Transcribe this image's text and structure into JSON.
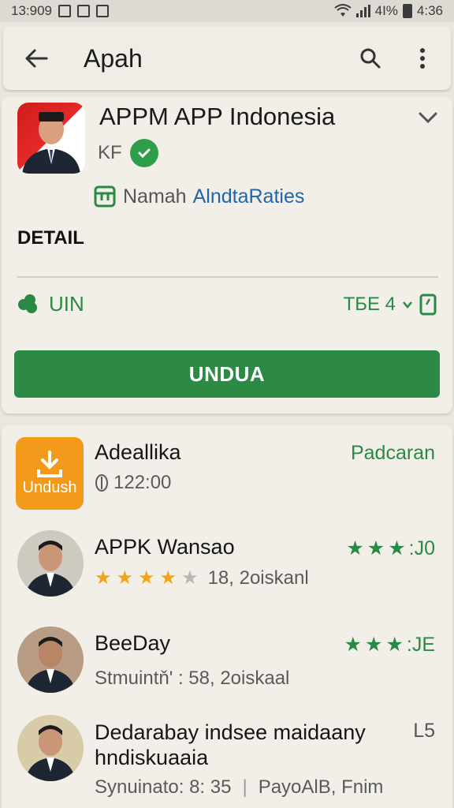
{
  "status_bar": {
    "time": "13:909",
    "right_text": "4I%",
    "right_time": "4:36"
  },
  "app_bar": {
    "title": "Apah",
    "icons": [
      "back-arrow-icon",
      "search-icon",
      "more-vert-icon"
    ]
  },
  "app": {
    "name": "APPM APP Indonesia",
    "developer": "KF",
    "category_label": "Namah",
    "category_link": "AlndtaRaties",
    "detail_label": "DETAIL",
    "meta_left": "UIN",
    "meta_right": "TБE 4",
    "install_label": "UNDUA"
  },
  "list": [
    {
      "title": "Adeallika",
      "subtitle": "122:00",
      "icon_text": "Undush",
      "right": "Padcaran"
    },
    {
      "title": "APPK Wansao",
      "stars_filled": 4,
      "stars_total": 5,
      "subtitle": "18, 2oiskanl",
      "right_stars": 3,
      "right": ":J0"
    },
    {
      "title": "BeeDay",
      "subtitle": "Stmuintň' : 58, 2oiskaal",
      "right_stars": 3,
      "right": ":JE"
    },
    {
      "title": "Dedarabay indsee maidaany",
      "title_line2": "hndiskuaaia",
      "subtitle": "Synuinato: 8: 35",
      "subtitle_extra": "PayoAlB, Fnim",
      "right": "L5"
    }
  ],
  "colors": {
    "accent_green": "#2d8a44",
    "link_blue": "#2166a8",
    "orange": "#f49a1a",
    "star_gold": "#f2a51a"
  }
}
